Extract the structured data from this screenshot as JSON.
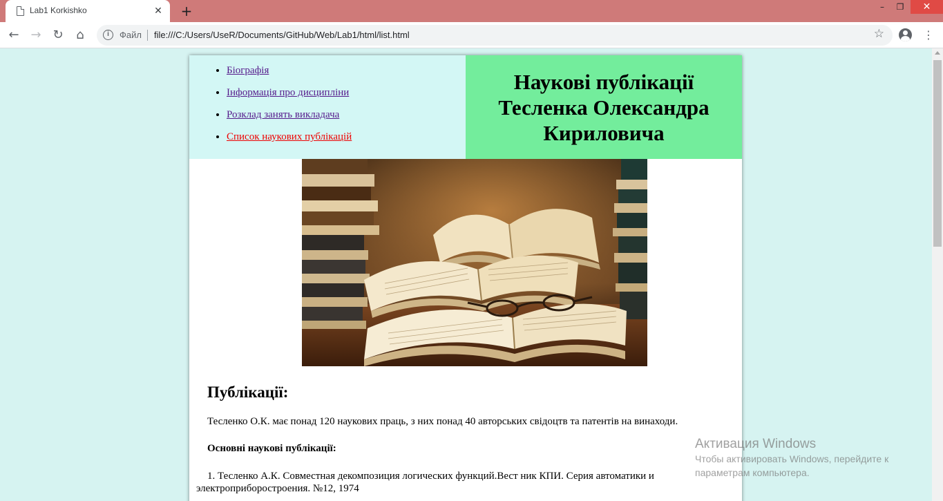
{
  "browser": {
    "tab_title": "Lab1 Korkishko",
    "tab_close_glyph": "✕",
    "new_tab_glyph": "+",
    "window_minimize_glyph": "–",
    "window_restore_glyph": "❐",
    "window_close_glyph": "✕",
    "back_glyph": "←",
    "forward_glyph": "→",
    "reload_glyph": "↻",
    "home_glyph": "⌂",
    "info_glyph": "i",
    "scheme_label": "Файл",
    "url": "file:///C:/Users/UseR/Documents/GitHub/Web/Lab1/html/list.html",
    "star_glyph": "☆",
    "menu_glyph": "⋮",
    "titlebar_color": "#cf7a79"
  },
  "page": {
    "nav": [
      {
        "label": "Біографія",
        "active": false
      },
      {
        "label": "Інформація про дисципліни",
        "active": false
      },
      {
        "label": "Розклад занять викладача",
        "active": false
      },
      {
        "label": "Список наукових публікацій",
        "active": true
      }
    ],
    "title": "Наукові публікації Тесленка Олександра Кириловича",
    "hero_image_icon": "open-books-image",
    "heading": "Публікації:",
    "intro": "Тесленко О.К. має понад 120 наукових праць, з них понад 40 авторських свідоцтв та патентів на винаходи.",
    "main_label": "Основні наукові публікації:",
    "publications": [
      "1. Тесленко А.К. Совместная декомпозиция логических функций.Вест ник КПИ. Серия автоматики и электроприборостроения. №12, 1974"
    ],
    "colors": {
      "background": "#d6f3f1",
      "nav_panel": "#d3f7f5",
      "title_panel": "#73ed9c",
      "visited_link": "#551a8b",
      "active_link": "#ee0000"
    }
  },
  "watermark": {
    "title": "Активация Windows",
    "subtitle": "Чтобы активировать Windows, перейдите к параметрам компьютера."
  }
}
